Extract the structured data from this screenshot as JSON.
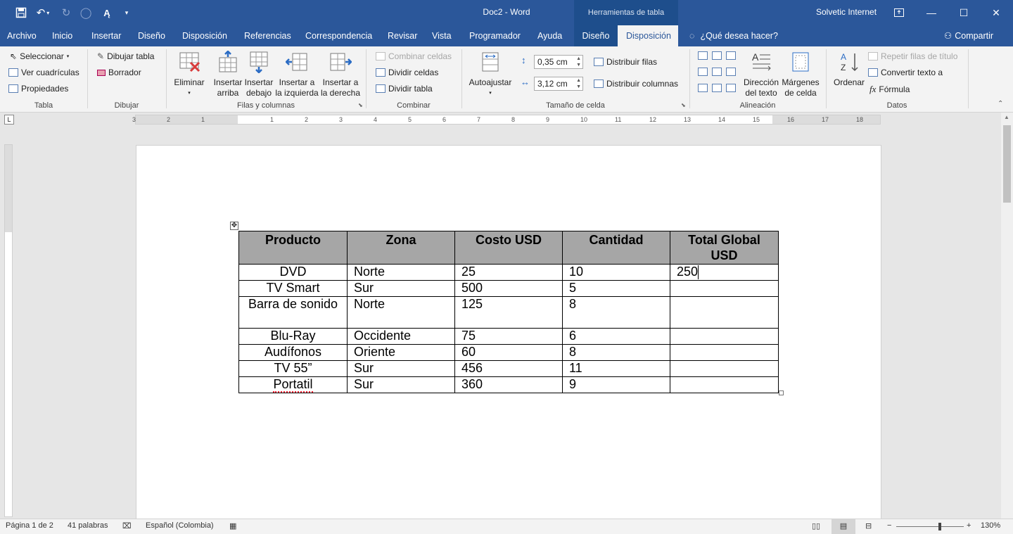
{
  "app": {
    "doc_title": "Doc2  -  Word",
    "context_header": "Herramientas de tabla",
    "user": "Solvetic Internet"
  },
  "tabs": [
    "Archivo",
    "Inicio",
    "Insertar",
    "Diseño",
    "Disposición",
    "Referencias",
    "Correspondencia",
    "Revisar",
    "Vista",
    "Programador",
    "Ayuda",
    "Diseño",
    "Disposición"
  ],
  "tell_me": "¿Qué desea hacer?",
  "share": "Compartir",
  "ribbon": {
    "tabla": {
      "label": "Tabla",
      "select": "Seleccionar",
      "gridlines": "Ver cuadrículas",
      "properties": "Propiedades"
    },
    "dibujar": {
      "label": "Dibujar",
      "draw": "Dibujar tabla",
      "eraser": "Borrador"
    },
    "filas": {
      "label": "Filas y columnas",
      "delete": "Eliminar",
      "above": [
        "Insertar",
        "arriba"
      ],
      "below": [
        "Insertar",
        "debajo"
      ],
      "left": [
        "Insertar a",
        "la izquierda"
      ],
      "right": [
        "Insertar a",
        "la derecha"
      ]
    },
    "combinar": {
      "label": "Combinar",
      "merge": "Combinar celdas",
      "split_cells": "Dividir celdas",
      "split_table": "Dividir tabla"
    },
    "tamano": {
      "label": "Tamaño de celda",
      "autofit": "Autoajustar",
      "height": "0,35 cm",
      "width": "3,12 cm",
      "dist_rows": "Distribuir filas",
      "dist_cols": "Distribuir columnas"
    },
    "alineacion": {
      "label": "Alineación",
      "direction": [
        "Dirección",
        "del texto"
      ],
      "margins": [
        "Márgenes",
        "de celda"
      ]
    },
    "datos": {
      "label": "Datos",
      "sort": "Ordenar",
      "repeat": "Repetir filas de título",
      "convert": "Convertir texto a",
      "formula": "Fórmula"
    }
  },
  "ruler_numbers": [
    "3",
    "2",
    "1",
    "1",
    "2",
    "3",
    "4",
    "5",
    "6",
    "7",
    "8",
    "9",
    "10",
    "11",
    "12",
    "13",
    "14",
    "15",
    "16",
    "17",
    "18"
  ],
  "table": {
    "headers": [
      "Producto",
      "Zona",
      "Costo USD",
      "Cantidad",
      "Total Global USD"
    ],
    "rows": [
      [
        "DVD",
        "Norte",
        "25",
        "10",
        "250"
      ],
      [
        "TV Smart",
        "Sur",
        "500",
        "5",
        ""
      ],
      [
        "Barra de sonido",
        "Norte",
        "125",
        "8",
        ""
      ],
      [
        "Blu-Ray",
        "Occidente",
        "75",
        "6",
        ""
      ],
      [
        "Audífonos",
        "Oriente",
        "60",
        "8",
        ""
      ],
      [
        "TV 55”",
        "Sur",
        "456",
        "11",
        ""
      ],
      [
        "Portatil",
        "Sur",
        "360",
        "9",
        ""
      ]
    ]
  },
  "status": {
    "page": "Página 1 de 2",
    "words": "41 palabras",
    "language": "Español (Colombia)",
    "zoom": "130%",
    "zoom_level": 0.65
  }
}
